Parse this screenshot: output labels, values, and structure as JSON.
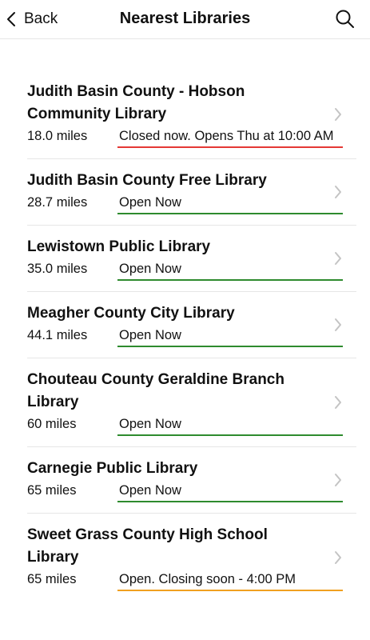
{
  "nav": {
    "back_label": "Back",
    "title": "Nearest Libraries",
    "back_icon": "chevron-left-icon",
    "search_icon": "search-icon"
  },
  "colors": {
    "open": "#2e8b2e",
    "closed": "#e53935",
    "closing": "#f0a020"
  },
  "libraries": [
    {
      "name": "Judith Basin County - Hobson Community Library",
      "distance": "18.0 miles",
      "status": "Closed now. Opens Thu at 10:00 AM",
      "status_type": "closed"
    },
    {
      "name": "Judith Basin County Free Library",
      "distance": "28.7 miles",
      "status": "Open Now",
      "status_type": "open"
    },
    {
      "name": "Lewistown Public Library",
      "distance": "35.0 miles",
      "status": "Open Now",
      "status_type": "open"
    },
    {
      "name": "Meagher County City Library",
      "distance": "44.1 miles",
      "status": "Open Now",
      "status_type": "open"
    },
    {
      "name": "Chouteau County Geraldine Branch Library",
      "distance": "60 miles",
      "status": "Open Now",
      "status_type": "open"
    },
    {
      "name": "Carnegie Public Library",
      "distance": "65 miles",
      "status": "Open Now",
      "status_type": "open"
    },
    {
      "name": "Sweet Grass County High School Library",
      "distance": "65 miles",
      "status": "Open. Closing soon - 4:00 PM",
      "status_type": "closing"
    }
  ]
}
